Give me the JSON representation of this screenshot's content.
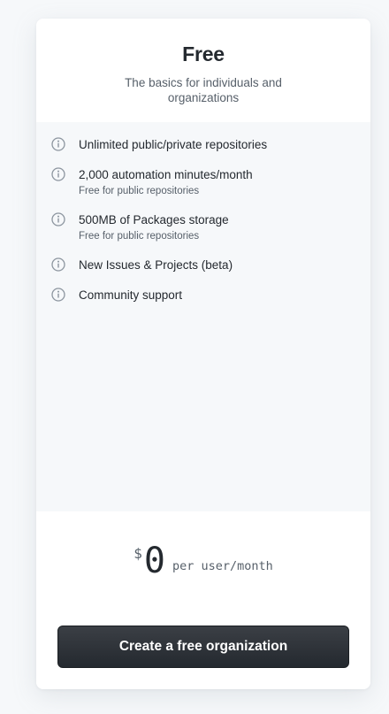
{
  "plan": {
    "title": "Free",
    "subtitle": "The basics for individuals and organizations"
  },
  "features": [
    {
      "title": "Unlimited public/private repositories",
      "note": "",
      "icon": "info-icon"
    },
    {
      "title": "2,000 automation minutes/month",
      "note": "Free for public repositories",
      "icon": "info-icon"
    },
    {
      "title": "500MB of Packages storage",
      "note": "Free for public repositories",
      "icon": "info-icon"
    },
    {
      "title": "New Issues & Projects (beta)",
      "note": "",
      "icon": "info-icon"
    },
    {
      "title": "Community support",
      "note": "",
      "icon": "info-icon"
    }
  ],
  "pricing": {
    "currency": "$",
    "amount": "0",
    "period": "per user/month"
  },
  "cta": {
    "label": "Create a free organization"
  },
  "colors": {
    "page_background": "#f6f8fa",
    "card_background": "#ffffff",
    "features_background": "#f6f8fa",
    "text_primary": "#24292f",
    "text_secondary": "#57606a",
    "button_background": "#24292f",
    "icon": "#8c959f"
  }
}
